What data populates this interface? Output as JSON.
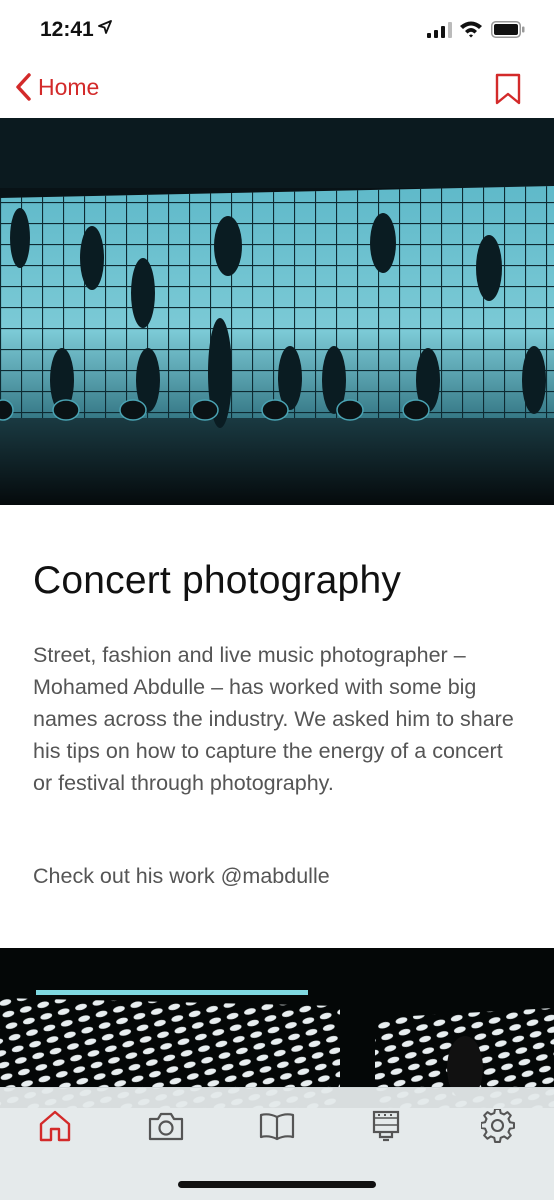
{
  "status_bar": {
    "time": "12:41"
  },
  "nav": {
    "back_label": "Home"
  },
  "article": {
    "title": "Concert photography",
    "body": "Street, fashion and live music photographer – Mohamed Abdulle – has worked with some big names across the industry. We asked him to share his tips on how to capture the energy of a concert or festival through photography.",
    "cta": "Check out his work @mabdulle"
  },
  "tabs": [
    {
      "icon": "home-icon",
      "active": true
    },
    {
      "icon": "camera-icon",
      "active": false
    },
    {
      "icon": "book-icon",
      "active": false
    },
    {
      "icon": "film-icon",
      "active": false
    },
    {
      "icon": "gear-icon",
      "active": false
    }
  ],
  "colors": {
    "accent": "#d32a2a",
    "hero_teal": "#4fb3c4"
  }
}
